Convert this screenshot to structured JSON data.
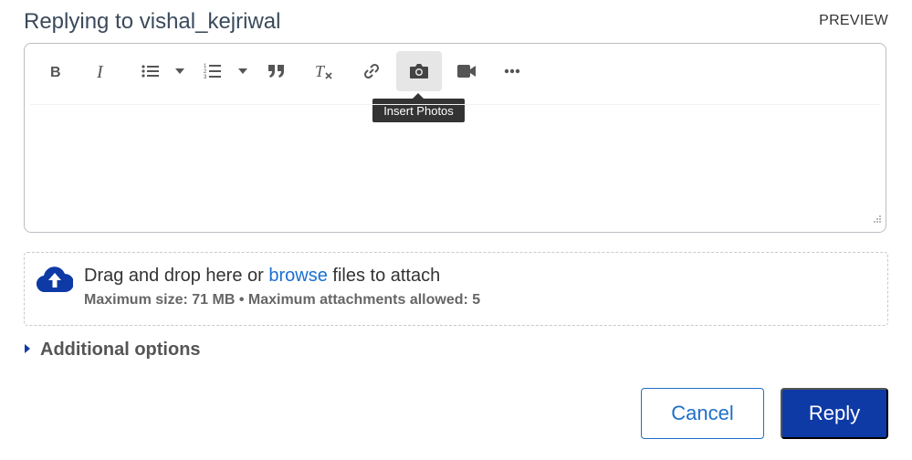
{
  "header": {
    "title": "Replying to vishal_kejriwal",
    "preview_label": "PREVIEW"
  },
  "toolbar": {
    "tooltip": "Insert Photos",
    "items": [
      {
        "name": "bold",
        "icon": "bold-icon"
      },
      {
        "name": "italic",
        "icon": "italic-icon"
      },
      {
        "name": "bulleted-list",
        "icon": "bulleted-list-icon"
      },
      {
        "name": "bulleted-list-options",
        "icon": "caret-down-icon"
      },
      {
        "name": "numbered-list",
        "icon": "numbered-list-icon"
      },
      {
        "name": "numbered-list-options",
        "icon": "caret-down-icon"
      },
      {
        "name": "quote",
        "icon": "quote-icon"
      },
      {
        "name": "clear-formatting",
        "icon": "clear-formatting-icon"
      },
      {
        "name": "insert-link",
        "icon": "link-icon"
      },
      {
        "name": "insert-photos",
        "icon": "camera-icon",
        "active": true
      },
      {
        "name": "insert-video",
        "icon": "video-icon"
      },
      {
        "name": "more",
        "icon": "more-icon"
      }
    ]
  },
  "editor": {
    "content": ""
  },
  "attachments": {
    "drag_prefix": "Drag and drop here or ",
    "browse_link": "browse",
    "drag_suffix": " files to attach",
    "limits": "Maximum size: 71 MB • Maximum attachments allowed: 5"
  },
  "additional_options": {
    "label": "Additional options"
  },
  "actions": {
    "cancel_label": "Cancel",
    "reply_label": "Reply"
  },
  "colors": {
    "primary": "#0e3aa6",
    "link": "#1a6fd0",
    "tooltip_bg": "#333333"
  }
}
